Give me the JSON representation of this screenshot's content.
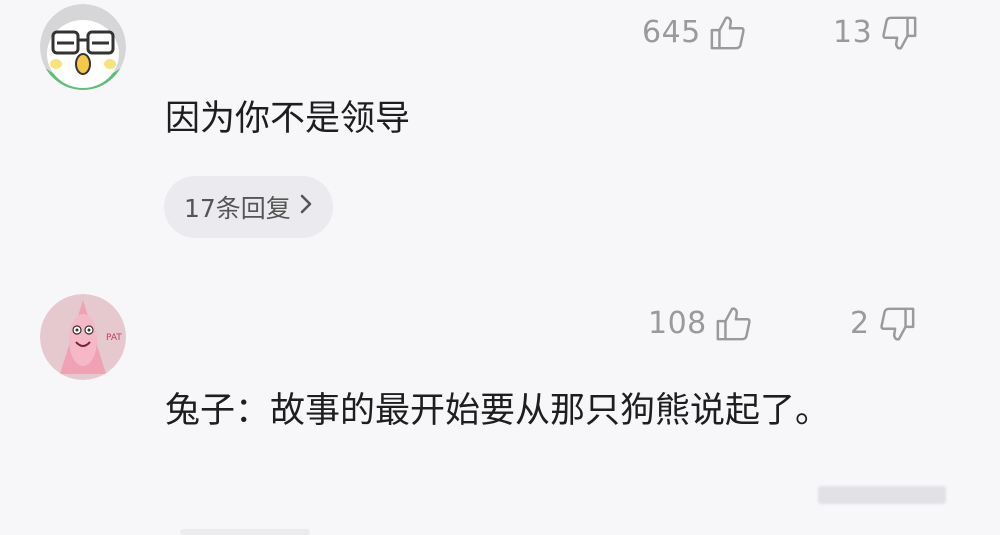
{
  "comments": [
    {
      "likes": "645",
      "dislikes": "13",
      "text": "因为你不是领导",
      "replies_label": "17条回复"
    },
    {
      "likes": "108",
      "dislikes": "2",
      "text": "兔子：故事的最开始要从那只狗熊说起了。",
      "avatar_badge": "PAT"
    }
  ],
  "colors": {
    "background": "#f7f6f9",
    "count_gray": "#9a9a9a",
    "pill_bg": "#ebeaee"
  },
  "icons": [
    "thumbs-up-icon",
    "thumbs-down-icon",
    "chevron-right-icon"
  ]
}
